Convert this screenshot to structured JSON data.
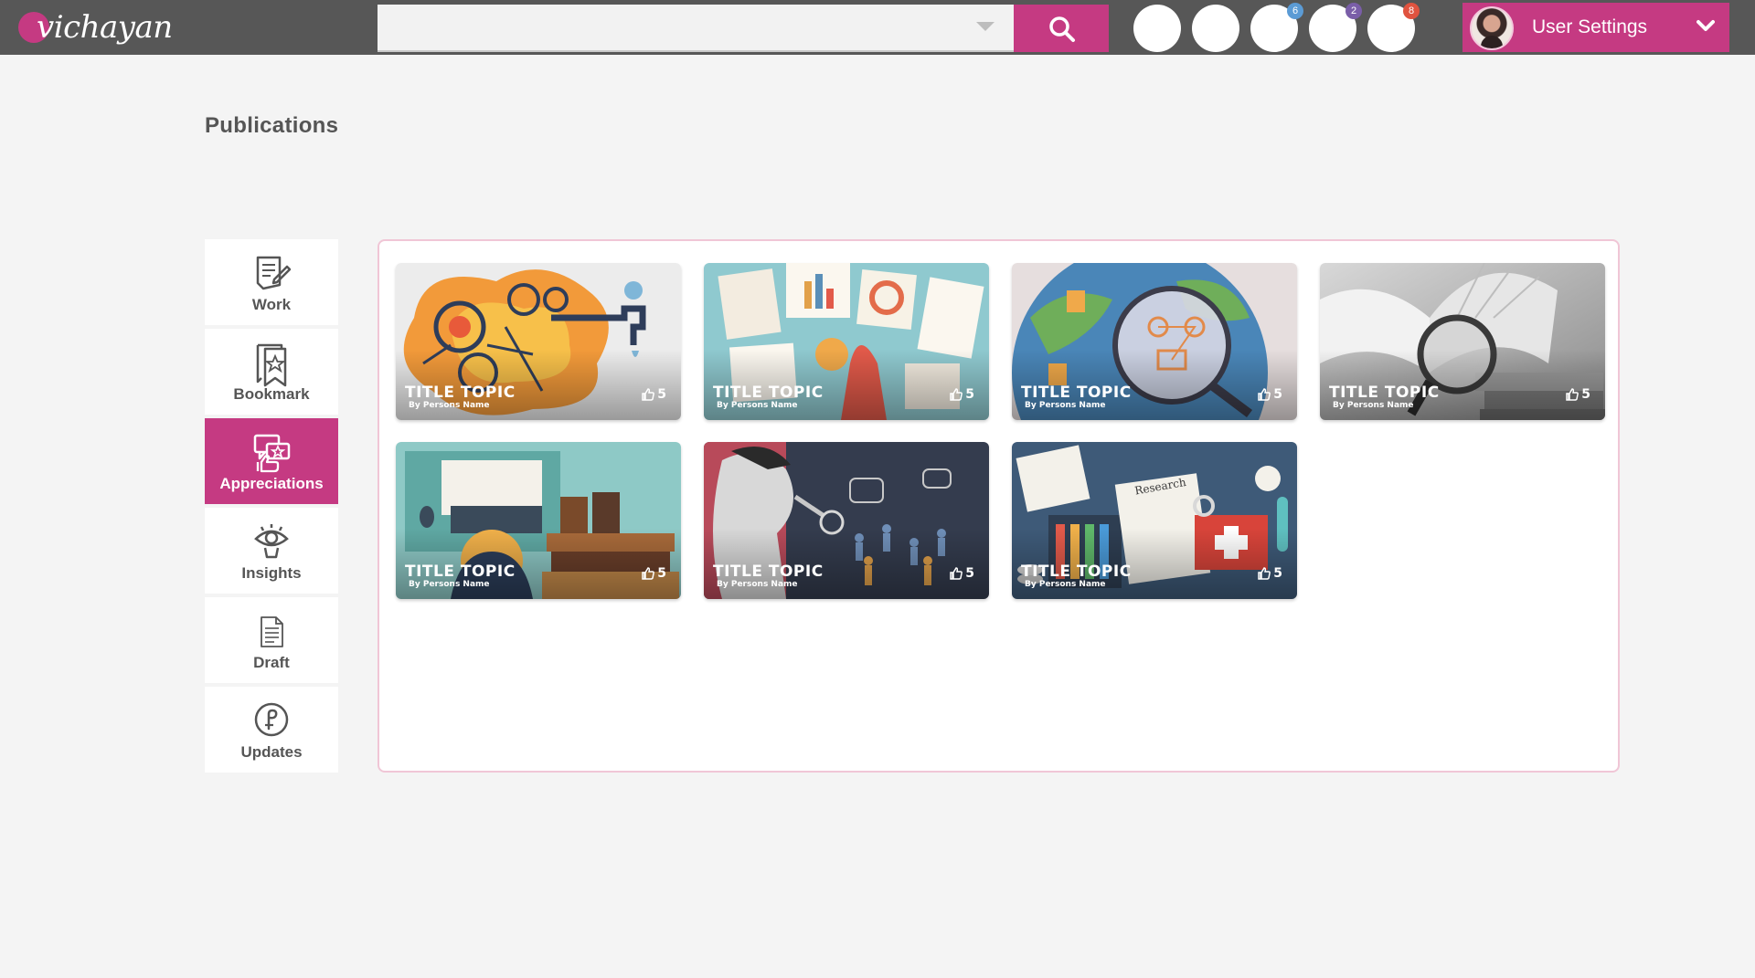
{
  "app": {
    "brand": "vichayan"
  },
  "header": {
    "search": {
      "value": "",
      "placeholder": ""
    },
    "icon_buttons": [
      {
        "name": "action-1",
        "badge": ""
      },
      {
        "name": "action-2",
        "badge": ""
      },
      {
        "name": "action-3",
        "badge": "6",
        "badge_color": "#5b9bd5"
      },
      {
        "name": "action-4",
        "badge": "2",
        "badge_color": "#7a5ea8"
      },
      {
        "name": "action-5",
        "badge": "8",
        "badge_color": "#e0533f"
      }
    ],
    "user_settings_label": "User Settings"
  },
  "page": {
    "title": "Publications"
  },
  "sidebar": {
    "items": [
      {
        "label": "Work",
        "icon": "work-icon",
        "active": false
      },
      {
        "label": "Bookmark",
        "icon": "bookmark-icon",
        "active": false
      },
      {
        "label": "Appreciations",
        "icon": "appreciations-icon",
        "active": true
      },
      {
        "label": "Insights",
        "icon": "insights-icon",
        "active": false
      },
      {
        "label": "Draft",
        "icon": "draft-icon",
        "active": false
      },
      {
        "label": "Updates",
        "icon": "updates-icon",
        "active": false
      }
    ]
  },
  "cards": [
    {
      "title": "TITLE TOPIC",
      "author": "By Persons Name",
      "likes": "5",
      "art": "gears-and-faucet"
    },
    {
      "title": "TITLE TOPIC",
      "author": "By Persons Name",
      "likes": "5",
      "art": "charts-on-desk"
    },
    {
      "title": "TITLE TOPIC",
      "author": "By Persons Name",
      "likes": "5",
      "art": "globe-magnifier"
    },
    {
      "title": "TITLE TOPIC",
      "author": "By Persons Name",
      "likes": "5",
      "art": "books-magnifier"
    },
    {
      "title": "TITLE TOPIC",
      "author": "By Persons Name",
      "likes": "5",
      "art": "laptop-and-books"
    },
    {
      "title": "TITLE TOPIC",
      "author": "By Persons Name",
      "likes": "5",
      "art": "researcher-crowd"
    },
    {
      "title": "TITLE TOPIC",
      "author": "By Persons Name",
      "likes": "5",
      "art": "research-lab"
    }
  ],
  "colors": {
    "accent": "#c53a82",
    "topbar": "#575757",
    "background": "#f4f4f4",
    "panel_border": "#f0c6d6"
  }
}
